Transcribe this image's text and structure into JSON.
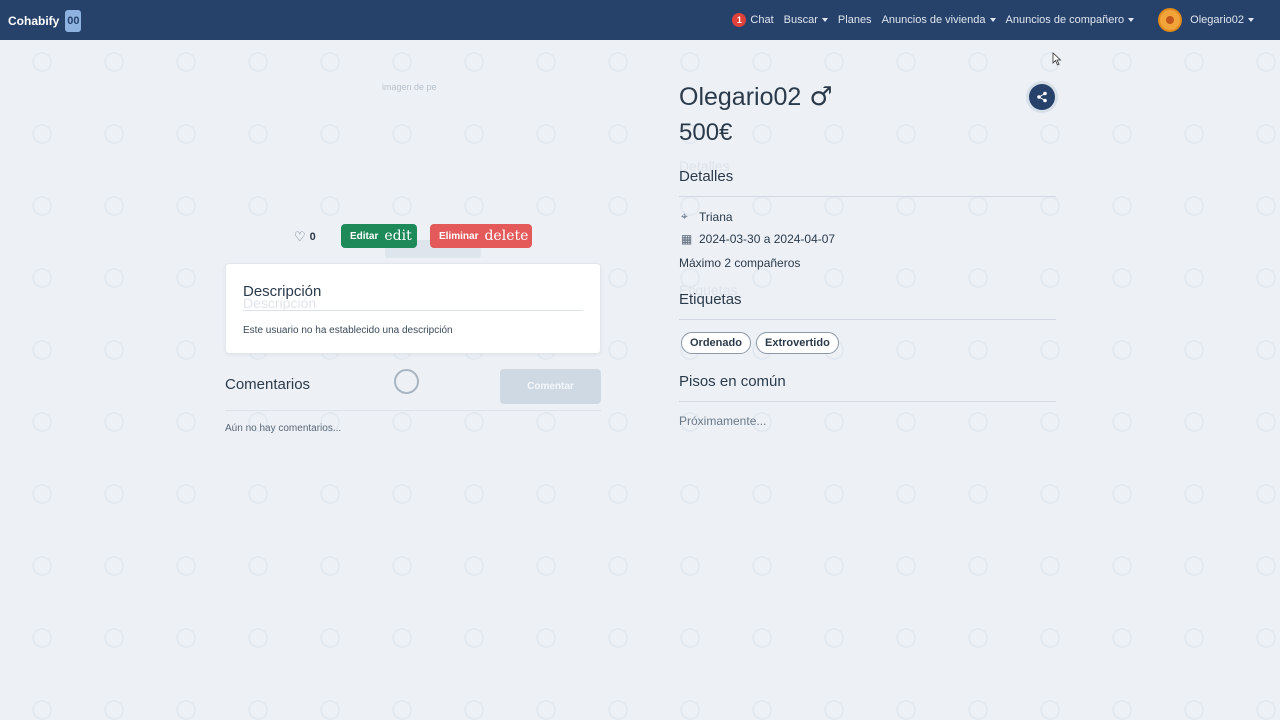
{
  "navbar": {
    "brand": "Cohabify",
    "logo_glyph": "00",
    "chat_badge": "1",
    "chat": "Chat",
    "buscar": "Buscar",
    "planes": "Planes",
    "anuncios_vivienda": "Anuncios de vivienda",
    "anuncios_companero": "Anuncios de compañero",
    "username": "Olegario02"
  },
  "left": {
    "image_placeholder": "imagen de pe",
    "likes": "0",
    "edit_label": "Editar",
    "edit_icon_text": "edit",
    "delete_label": "Eliminar",
    "delete_icon_text": "delete",
    "description_title": "Descripción",
    "description_text": "Este usuario no ha establecido una descripción",
    "comments_title": "Comentarios",
    "comment_button": "Comentar",
    "no_comments": "Aún no hay comentarios..."
  },
  "right": {
    "username": "Olegario02",
    "gender_symbol": "♂",
    "price": "500€",
    "details_title": "Detalles",
    "location": "Triana",
    "dates": "2024-03-30 a 2024-04-07",
    "max_companions": "Máximo 2 compañeros",
    "tags_title": "Etiquetas",
    "tags": [
      "Ordenado",
      "Extrovertido"
    ],
    "common_title": "Pisos en común",
    "common_text": "Próximamente..."
  },
  "colors": {
    "navbar": "#26416a",
    "edit_button": "#1e8a5a",
    "delete_button": "#e45a5a",
    "badge": "#e0413b"
  }
}
